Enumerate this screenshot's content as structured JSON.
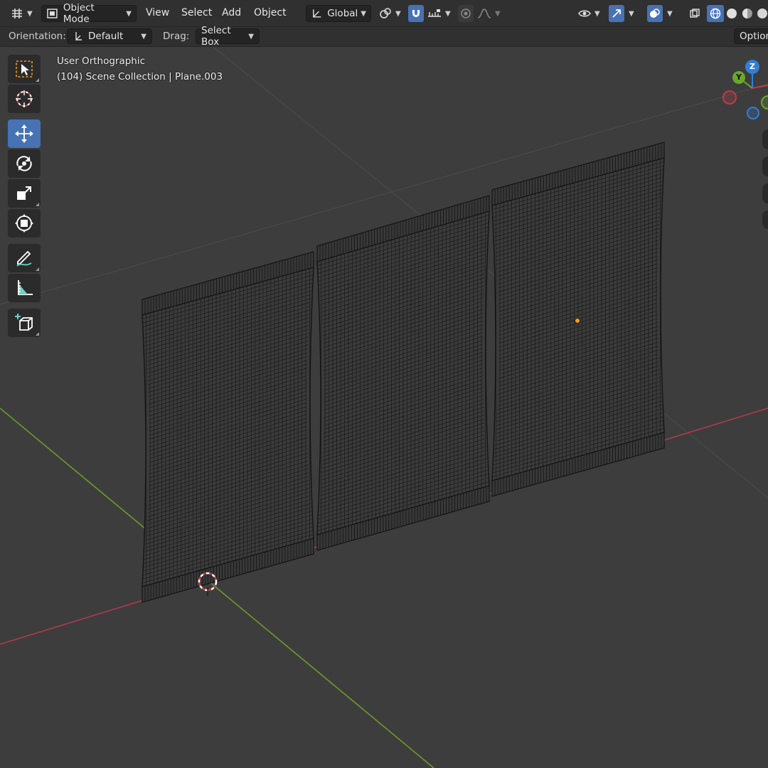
{
  "header": {
    "mode_label": "Object Mode",
    "menus": [
      "View",
      "Select",
      "Add",
      "Object"
    ],
    "transform_orientation": "Global",
    "options_label": "Option"
  },
  "subheader": {
    "orientation_label": "Orientation:",
    "orientation_value": "Default",
    "drag_label": "Drag:",
    "drag_value": "Select Box"
  },
  "viewport": {
    "view_name": "User Orthographic",
    "collection_info": "(104) Scene Collection | Plane.003",
    "gizmo": {
      "z_label": "Z",
      "y_label": "Y"
    }
  },
  "tools": [
    {
      "name": "select-box-tool",
      "icon": "select-box-icon"
    },
    {
      "name": "cursor-tool",
      "icon": "cursor-icon"
    },
    {
      "name": "move-tool",
      "icon": "move-icon",
      "active": true
    },
    {
      "name": "rotate-tool",
      "icon": "rotate-icon"
    },
    {
      "name": "scale-tool",
      "icon": "scale-icon"
    },
    {
      "name": "transform-tool",
      "icon": "transform-icon"
    },
    {
      "name": "annotate-tool",
      "icon": "annotate-icon"
    },
    {
      "name": "measure-tool",
      "icon": "measure-icon"
    },
    {
      "name": "add-cube-tool",
      "icon": "add-cube-icon"
    }
  ],
  "colors": {
    "background": "#3d3d3d",
    "header": "#303030",
    "accent": "#4772b3",
    "x_axis": "#b23a48",
    "y_axis": "#6b9a2b",
    "wire": "#141414"
  }
}
